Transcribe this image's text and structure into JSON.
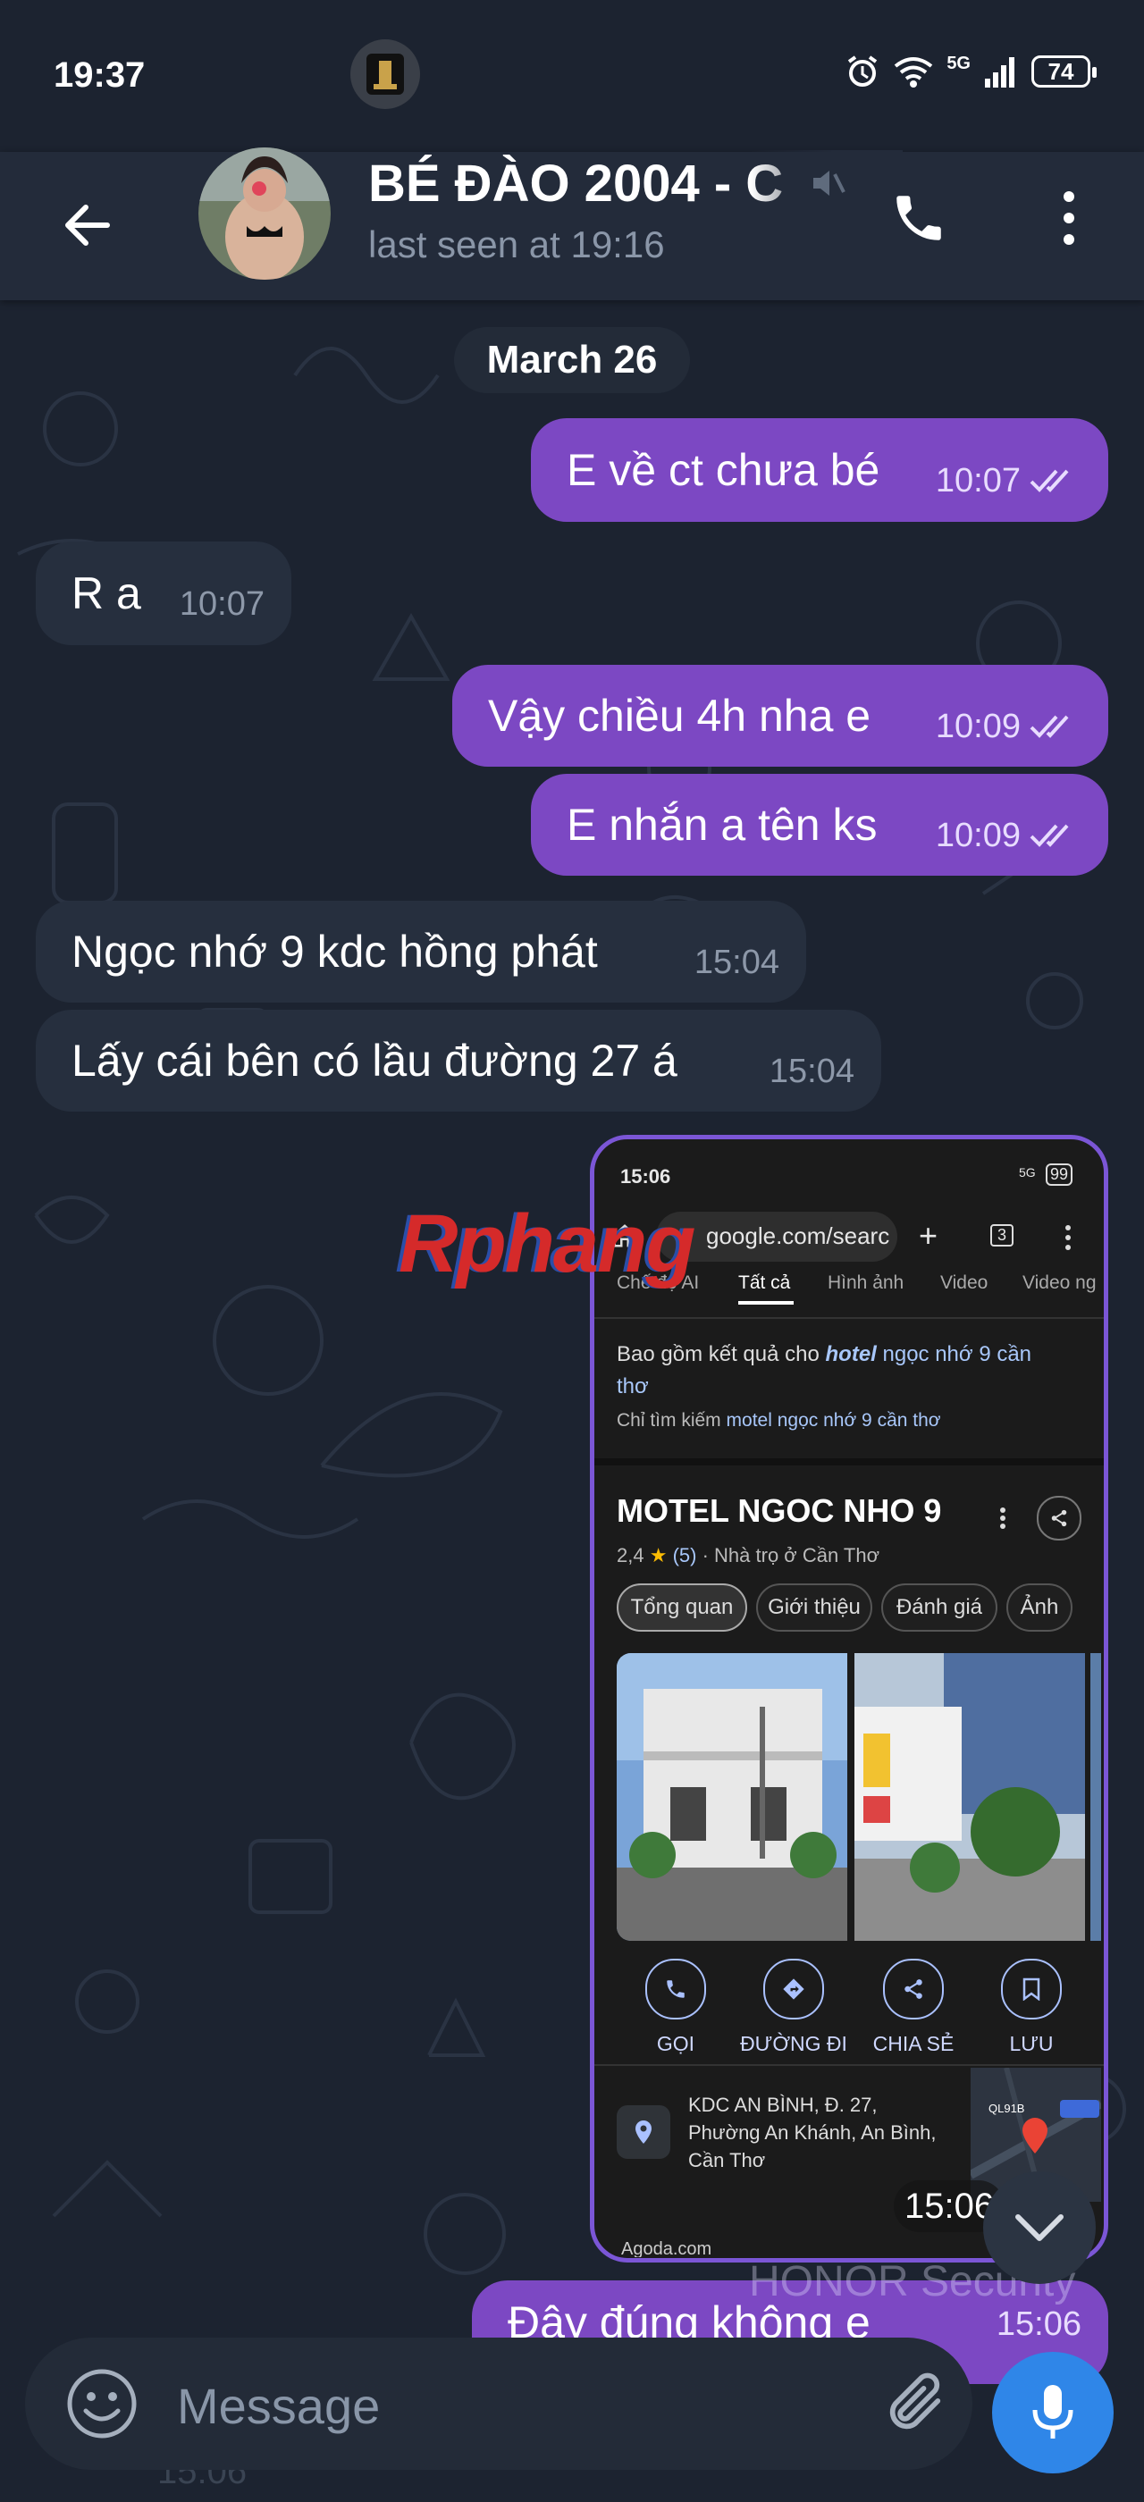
{
  "status_bar": {
    "time": "19:37",
    "app_icon": "game-app-icon",
    "network_label": "5G",
    "battery": "74"
  },
  "header": {
    "back_icon": "arrow-left-icon",
    "title": "BÉ ĐÀO 2004 - C",
    "subtitle": "last seen at 19:16",
    "muted_icon": "muted-speaker-icon",
    "call_icon": "phone-icon",
    "more_icon": "vertical-dots-icon"
  },
  "chat": {
    "date": "March 26",
    "messages": [
      {
        "side": "out",
        "text": "E về ct chưa bé",
        "time": "10:07",
        "status": "read"
      },
      {
        "side": "in",
        "text": "R a",
        "time": "10:07"
      },
      {
        "side": "out",
        "text": "Vậy chiều 4h nha e",
        "time": "10:09",
        "status": "read"
      },
      {
        "side": "out",
        "text": "E nhắn a tên ks",
        "time": "10:09",
        "status": "read"
      },
      {
        "side": "in",
        "text": "Ngọc nhớ 9 kdc hồng phát",
        "time": "15:04"
      },
      {
        "side": "in",
        "text": "Lấy cái bên có lầu đường 27 á",
        "time": "15:04"
      },
      {
        "side": "out",
        "text": "Đây đúng không e",
        "time": "15:06",
        "status": "read"
      }
    ],
    "media_time": "15:06",
    "footer_partial_time": "15:06"
  },
  "screenshot_media": {
    "status_time": "15:06",
    "status_network": "5G",
    "status_battery": "99",
    "url": "google.com/searc",
    "tabs_count": "3",
    "search_tabs": [
      "Chế độ AI",
      "Tất cả",
      "Hình ảnh",
      "Video",
      "Video ng"
    ],
    "active_tab": "Tất cả",
    "includes_prefix": "Bao gồm kết quả cho",
    "includes_bold": "hotel",
    "includes_suffix": "ngọc nhớ 9 cần thơ",
    "only_prefix": "Chỉ tìm kiếm",
    "only_query": "motel ngọc nhớ 9 cần thơ",
    "place_name": "MOTEL NGOC NHO 9",
    "rating": "2,4",
    "rating_star": "★",
    "reviews": "(5)",
    "category": "· Nhà trọ ở Cần Thơ",
    "chips": [
      "Tổng quan",
      "Giới thiệu",
      "Đánh giá",
      "Ảnh"
    ],
    "actions": [
      {
        "label": "GỌI",
        "icon": "phone-icon"
      },
      {
        "label": "ĐƯỜNG ĐI",
        "icon": "directions-icon"
      },
      {
        "label": "CHIA SẺ",
        "icon": "share-icon"
      },
      {
        "label": "LƯU",
        "icon": "bookmark-icon"
      }
    ],
    "address_lines": [
      "KDC AN BÌNH, Đ. 27,",
      "Phường An Khánh, An Bình,",
      "Cần Thơ"
    ],
    "map_road_label": "QL91B",
    "agoda": "Agoda.com"
  },
  "overlays": {
    "watermark": "Rphang",
    "honor_label": "HONOR Security"
  },
  "input": {
    "placeholder": "Message"
  },
  "colors": {
    "outgoing_bubble": "#7c48c3",
    "incoming_bubble": "#262f3e",
    "accent_blue": "#2f86e8",
    "header_bg": "#232b3a"
  }
}
